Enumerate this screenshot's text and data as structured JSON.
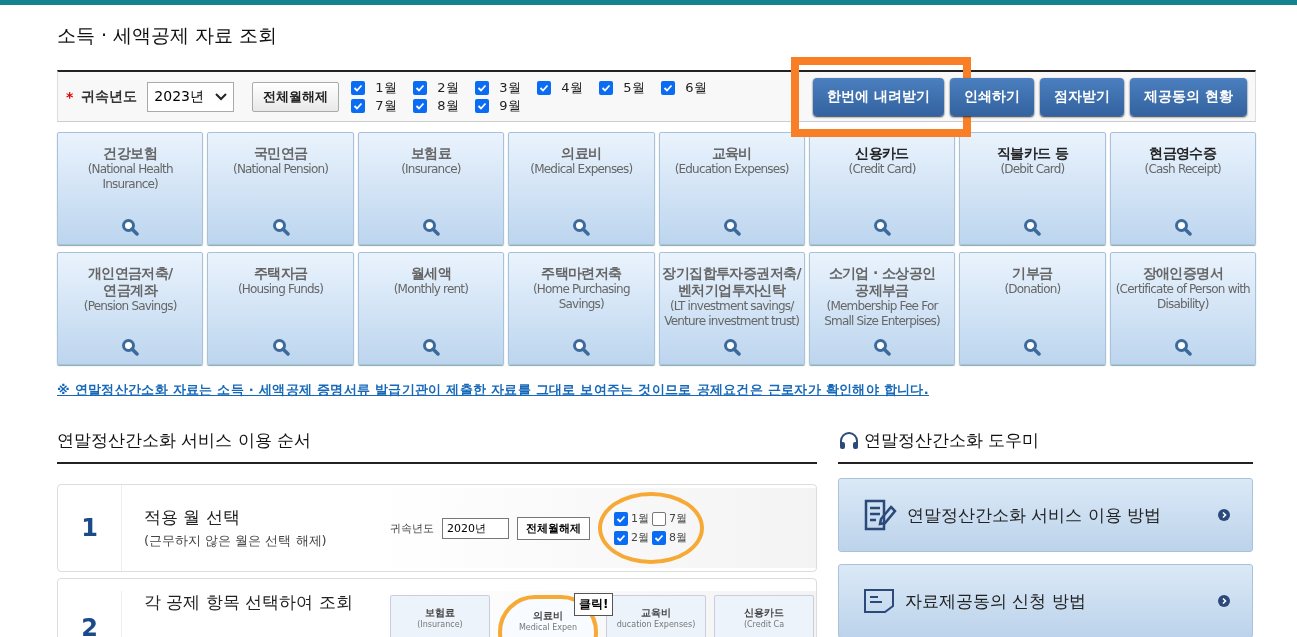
{
  "page_title": "소득 · 세액공제 자료 조회",
  "filter": {
    "required_mark": "*",
    "year_label": "귀속년도",
    "year_value": "2023년",
    "clear_button": "전체월해제",
    "months": [
      {
        "label": "1월",
        "checked": true
      },
      {
        "label": "2월",
        "checked": true
      },
      {
        "label": "3월",
        "checked": true
      },
      {
        "label": "4월",
        "checked": true
      },
      {
        "label": "5월",
        "checked": true
      },
      {
        "label": "6월",
        "checked": true
      },
      {
        "label": "7월",
        "checked": true
      },
      {
        "label": "8월",
        "checked": true
      },
      {
        "label": "9월",
        "checked": true
      }
    ],
    "buttons": [
      {
        "label": "한번에 내려받기",
        "highlighted": true
      },
      {
        "label": "인쇄하기",
        "highlighted": false
      },
      {
        "label": "점자받기",
        "highlighted": false
      },
      {
        "label": "제공동의 현황",
        "highlighted": false
      }
    ]
  },
  "tiles": [
    {
      "title": "건강보험",
      "subtitle": "(National Health Insurance)",
      "emphasized": false
    },
    {
      "title": "국민연금",
      "subtitle": "(National Pension)",
      "emphasized": false
    },
    {
      "title": "보험료",
      "subtitle": "(Insurance)",
      "emphasized": false
    },
    {
      "title": "의료비",
      "subtitle": "(Medical Expenses)",
      "emphasized": false
    },
    {
      "title": "교육비",
      "subtitle": "(Education Expenses)",
      "emphasized": false
    },
    {
      "title": "신용카드",
      "subtitle": "(Credit Card)",
      "emphasized": true
    },
    {
      "title": "직불카드 등",
      "subtitle": "(Debit Card)",
      "emphasized": true
    },
    {
      "title": "현금영수증",
      "subtitle": "(Cash Receipt)",
      "emphasized": true
    },
    {
      "title": "개인연금저축/\n연금계좌",
      "subtitle": "(Pension Savings)",
      "emphasized": false
    },
    {
      "title": "주택자금",
      "subtitle": "(Housing Funds)",
      "emphasized": false
    },
    {
      "title": "월세액",
      "subtitle": "(Monthly rent)",
      "emphasized": false
    },
    {
      "title": "주택마련저축",
      "subtitle": "(Home Purchasing Savings)",
      "emphasized": false
    },
    {
      "title": "장기집합투자증권저축/\n벤처기업투자신탁",
      "subtitle": "(LT investment savings/ Venture investment trust)",
      "emphasized": false
    },
    {
      "title": "소기업 · 소상공인\n공제부금",
      "subtitle": "(Membership Fee For Small Size Enterpises)",
      "emphasized": false
    },
    {
      "title": "기부금",
      "subtitle": "(Donation)",
      "emphasized": false
    },
    {
      "title": "장애인증명서",
      "subtitle": "(Certificate of Person with Disability)",
      "emphasized": false
    }
  ],
  "notice": "※ 연말정산간소화 자료는 소득 · 세액공제 증명서류 발급기관이 제출한 자료를 그대로 보여주는 것이므로 공제요건은 근로자가 확인해야 합니다.",
  "guide": {
    "title": "연말정산간소화 서비스 이용 순서",
    "steps": [
      {
        "number": "1",
        "title": "적용 월 선택",
        "description": "(근무하지 않은 월은 선택 해제)",
        "illustration": {
          "kind": "month-select",
          "year_label": "귀속년도",
          "year_value": "2020년",
          "clear_button": "전체월해제",
          "months": [
            {
              "label": "1월",
              "checked": true
            },
            {
              "label": "7월",
              "checked": false
            },
            {
              "label": "2월",
              "checked": true
            },
            {
              "label": "8월",
              "checked": true
            }
          ]
        }
      },
      {
        "number": "2",
        "title": "각 공제 항목 선택하여 조회",
        "illustration": {
          "kind": "tile-select",
          "callout": "클릭!",
          "tiles": [
            {
              "title": "보험료",
              "subtitle": "(Insurance)",
              "selected": false
            },
            {
              "title": "의료비",
              "subtitle": "Medical Expen",
              "selected": true
            },
            {
              "title": "교육비",
              "subtitle": "ducation Expenses)",
              "selected": false
            },
            {
              "title": "신용카드",
              "subtitle": "(Credit Ca",
              "selected": false
            }
          ]
        }
      }
    ]
  },
  "help": {
    "title": "연말정산간소화 도우미",
    "items": [
      {
        "kind": "document",
        "label": "연말정산간소화 서비스 이용 방법"
      },
      {
        "kind": "form",
        "label": "자료제공동의 신청 방법"
      }
    ]
  }
}
